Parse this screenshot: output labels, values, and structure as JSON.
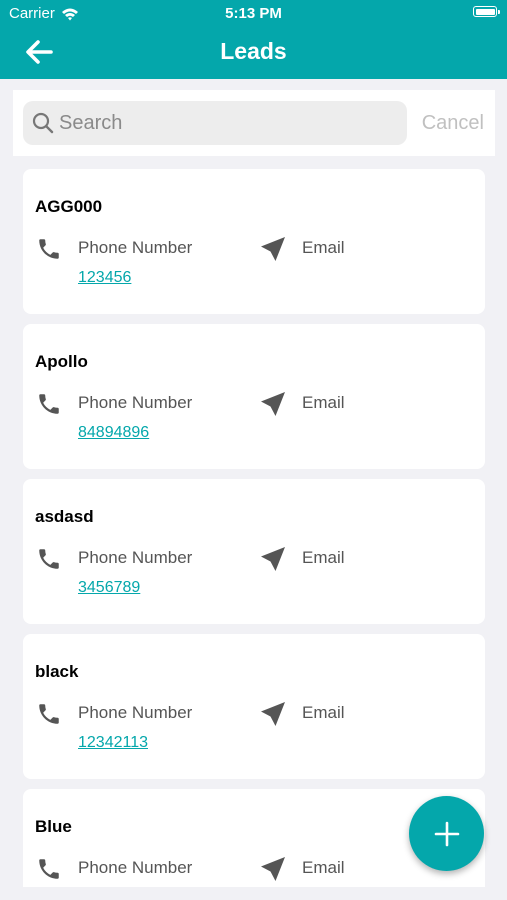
{
  "status_bar": {
    "carrier": "Carrier",
    "time": "5:13 PM"
  },
  "header": {
    "title": "Leads",
    "back_icon": "arrow-left-icon"
  },
  "search": {
    "placeholder": "Search",
    "value": "",
    "cancel_label": "Cancel"
  },
  "leads": [
    {
      "name": "AGG000",
      "phone_label": "Phone Number",
      "phone": "123456",
      "email_label": "Email"
    },
    {
      "name": "Apollo",
      "phone_label": "Phone Number",
      "phone": "84894896",
      "email_label": "Email"
    },
    {
      "name": "asdasd",
      "phone_label": "Phone Number",
      "phone": "3456789",
      "email_label": "Email"
    },
    {
      "name": "black",
      "phone_label": "Phone Number",
      "phone": "12342113",
      "email_label": "Email"
    },
    {
      "name": "Blue",
      "phone_label": "Phone Number",
      "phone": "",
      "email_label": "Email"
    }
  ],
  "fab": {
    "icon": "plus-icon"
  },
  "colors": {
    "brand": "#04a7ab",
    "background": "#f1f1f5",
    "card": "#ffffff"
  }
}
